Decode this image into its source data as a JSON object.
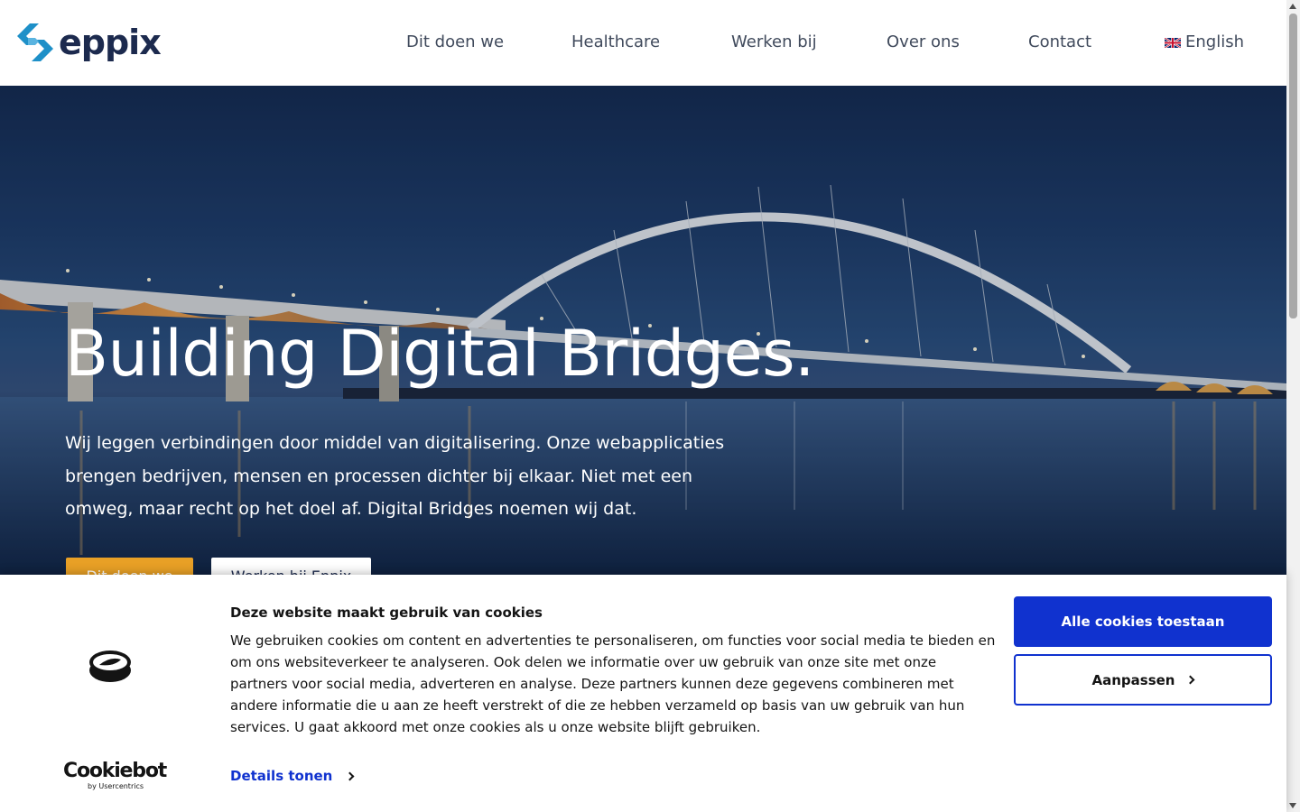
{
  "brand": {
    "logo_text": "eppix",
    "colors": {
      "navy": "#1c2a4e",
      "blue": "#1e90c8",
      "accent": "#e8a026",
      "cookie_blue": "#1032cf"
    }
  },
  "nav": {
    "items": [
      {
        "label": "Dit doen we"
      },
      {
        "label": "Healthcare"
      },
      {
        "label": "Werken bij"
      },
      {
        "label": "Over ons"
      },
      {
        "label": "Contact"
      }
    ],
    "language": {
      "label": "English",
      "icon": "uk-flag-icon"
    }
  },
  "hero": {
    "title": "Building Digital Bridges.",
    "text": "Wij leggen verbindingen door middel van digitalisering. Onze webapplicaties brengen bedrijven, mensen en processen dichter bij elkaar. Niet met een omweg, maar recht op het doel af. Digital Bridges noemen wij dat.",
    "primary_button": "Dit doen we",
    "secondary_button": "Werken bij Eppix"
  },
  "cookie_banner": {
    "title": "Deze website maakt gebruik van cookies",
    "text": "We gebruiken cookies om content en advertenties te personaliseren, om functies voor social media te bieden en om ons websiteverkeer te analyseren. Ook delen we informatie over uw gebruik van onze site met onze partners voor social media, adverteren en analyse. Deze partners kunnen deze gegevens combineren met andere informatie die u aan ze heeft verstrekt of die ze hebben verzameld op basis van uw gebruik van hun services. U gaat akkoord met onze cookies als u onze website blijft gebruiken.",
    "details_link": "Details tonen",
    "allow_button": "Alle cookies toestaan",
    "customize_button": "Aanpassen",
    "brand_name": "Cookiebot",
    "brand_sub": "by Usercentrics"
  }
}
